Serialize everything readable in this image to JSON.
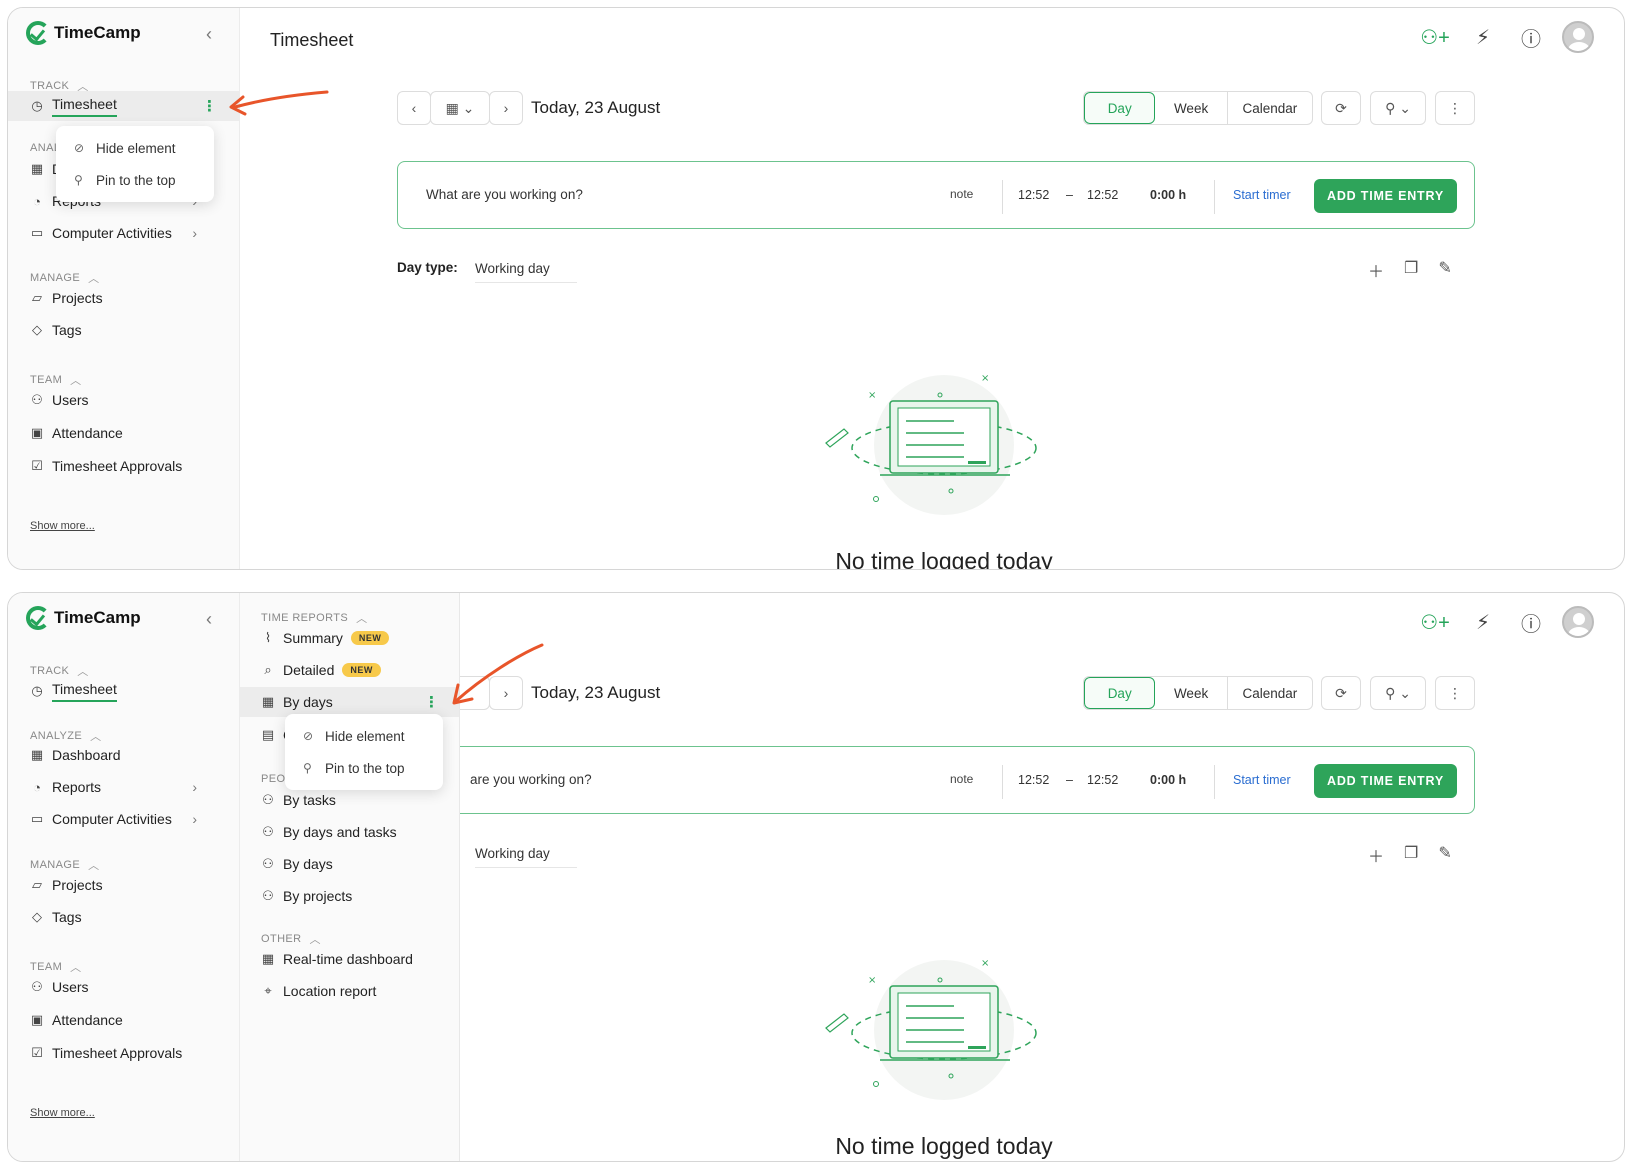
{
  "app": {
    "name": "TimeCamp",
    "page_title": "Timesheet"
  },
  "sidebar": {
    "track_header": "TRACK",
    "analyze_header": "ANALYZE",
    "analyze_header_partial": "ANAL",
    "manage_header": "MANAGE",
    "team_header": "TEAM",
    "items": {
      "timesheet": "Timesheet",
      "dashboard": "Dashboard",
      "dashboard_partial": "D",
      "reports": "Reports",
      "computer_activities": "Computer Activities",
      "projects": "Projects",
      "tags": "Tags",
      "users": "Users",
      "attendance": "Attendance",
      "timesheet_approvals": "Timesheet Approvals"
    },
    "show_more": "Show more..."
  },
  "context_menu": {
    "hide": "Hide element",
    "pin": "Pin to the top"
  },
  "toolbar": {
    "date_label": "Today, 23 August",
    "views": [
      "Day",
      "Week",
      "Calendar"
    ],
    "active_view": "Day"
  },
  "entry": {
    "placeholder": "What are you working on?",
    "placeholder_partial": "are you working on?",
    "note": "note",
    "start_time": "12:52",
    "dash": "–",
    "end_time": "12:52",
    "duration": "0:00 h",
    "start_timer": "Start timer",
    "add_button": "ADD TIME ENTRY"
  },
  "day_type": {
    "label": "Day type:",
    "value": "Working day"
  },
  "empty_state": {
    "message": "No time logged today"
  },
  "reports_menu": {
    "time_reports_header": "TIME REPORTS",
    "summary": "Summary",
    "detailed": "Detailed",
    "badge_new": "NEW",
    "by_days": "By days",
    "hidden_partial": "C",
    "people_header_partial": "PEOP",
    "by_tasks": "By tasks",
    "by_days_and_tasks": "By days and tasks",
    "by_days_people": "By days",
    "by_projects": "By projects",
    "other_header": "OTHER",
    "realtime_dashboard": "Real-time dashboard",
    "location_report": "Location report"
  },
  "colors": {
    "brand": "#25a45a",
    "arrow": "#e8552a",
    "link": "#2a6dd1",
    "badge": "#f7c94a"
  },
  "icons": [
    "clock-icon",
    "dashboard-icon",
    "reports-icon",
    "laptop-icon",
    "folder-icon",
    "tag-icon",
    "users-icon",
    "attendance-icon",
    "calendar-check-icon",
    "add-user-icon",
    "plug-icon",
    "help-icon",
    "avatar",
    "refresh-icon",
    "person-icon",
    "more-icon",
    "plus-icon",
    "copy-icon",
    "edit-icon"
  ]
}
